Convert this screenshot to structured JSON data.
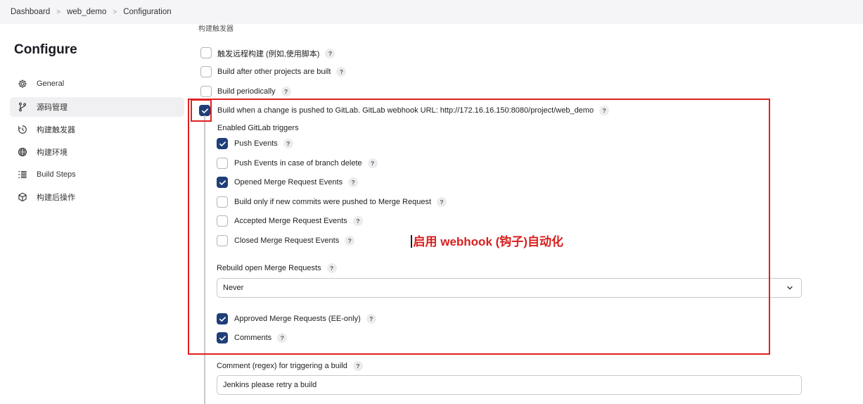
{
  "breadcrumb": [
    "Dashboard",
    "web_demo",
    "Configuration"
  ],
  "sidebar": {
    "title": "Configure",
    "items": [
      {
        "label": "General",
        "icon": "gear-icon"
      },
      {
        "label": "源码管理",
        "icon": "branch-icon"
      },
      {
        "label": "构建触发器",
        "icon": "clock-icon"
      },
      {
        "label": "构建环境",
        "icon": "globe-icon"
      },
      {
        "label": "Build Steps",
        "icon": "list-icon"
      },
      {
        "label": "构建后操作",
        "icon": "cube-icon"
      }
    ]
  },
  "main": {
    "section_heading": "构建触发器",
    "triggers": [
      {
        "label": "触发远程构建 (例如,使用脚本)",
        "checked": false
      },
      {
        "label": "Build after other projects are built",
        "checked": false
      },
      {
        "label": "Build periodically",
        "checked": false
      },
      {
        "label": "Build when a change is pushed to GitLab. GitLab webhook URL: http://172.16.16.150:8080/project/web_demo",
        "checked": true
      }
    ],
    "gitlab_heading": "Enabled GitLab triggers",
    "gitlab_triggers": [
      {
        "label": "Push Events",
        "checked": true
      },
      {
        "label": "Push Events in case of branch delete",
        "checked": false
      },
      {
        "label": "Opened Merge Request Events",
        "checked": true
      },
      {
        "label": "Build only if new commits were pushed to Merge Request",
        "checked": false
      },
      {
        "label": "Accepted Merge Request Events",
        "checked": false
      },
      {
        "label": "Closed Merge Request Events",
        "checked": false
      }
    ],
    "rebuild_label": "Rebuild open Merge Requests",
    "rebuild_value": "Never",
    "approved_label": "Approved Merge Requests (EE-only)",
    "approved_checked": true,
    "comments_label": "Comments",
    "comments_checked": true,
    "comment_regex_label": "Comment (regex) for triggering a build",
    "comment_regex_value": "Jenkins please retry a build",
    "help_glyph": "?"
  },
  "annotation": {
    "text": "启用 webhook (钩子)自动化",
    "color": "#d81e1e"
  },
  "colors": {
    "checkbox_checked": "#1e3f78",
    "highlight_box": "#e02020"
  }
}
